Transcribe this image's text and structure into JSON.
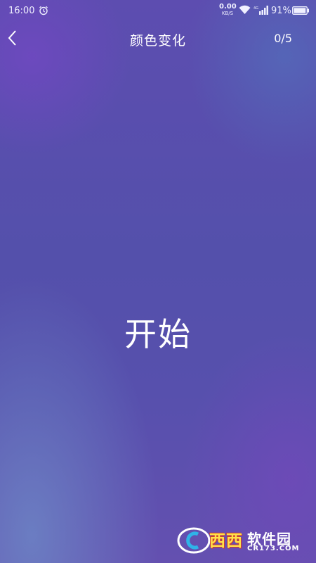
{
  "status_bar": {
    "time": "16:00",
    "net_speed_value": "0.00",
    "net_speed_unit": "KB/S",
    "network_type": "4G",
    "battery_percent": "91%",
    "icons": [
      "alarm-icon",
      "wifi-icon",
      "signal-icon",
      "battery-icon"
    ]
  },
  "header": {
    "back_icon": "chevron-left-icon",
    "title": "颜色变化",
    "progress": "0/5"
  },
  "main": {
    "start_label": "开始"
  },
  "watermark": {
    "brand": "西西",
    "name": "软件园",
    "domain": "CR173.COM"
  },
  "colors": {
    "background_primary": "#5650ad",
    "background_accent_light": "#6e8cc8",
    "text": "#ffffff",
    "watermark_yellow": "#ffe14a",
    "watermark_red": "#d23a2a"
  }
}
